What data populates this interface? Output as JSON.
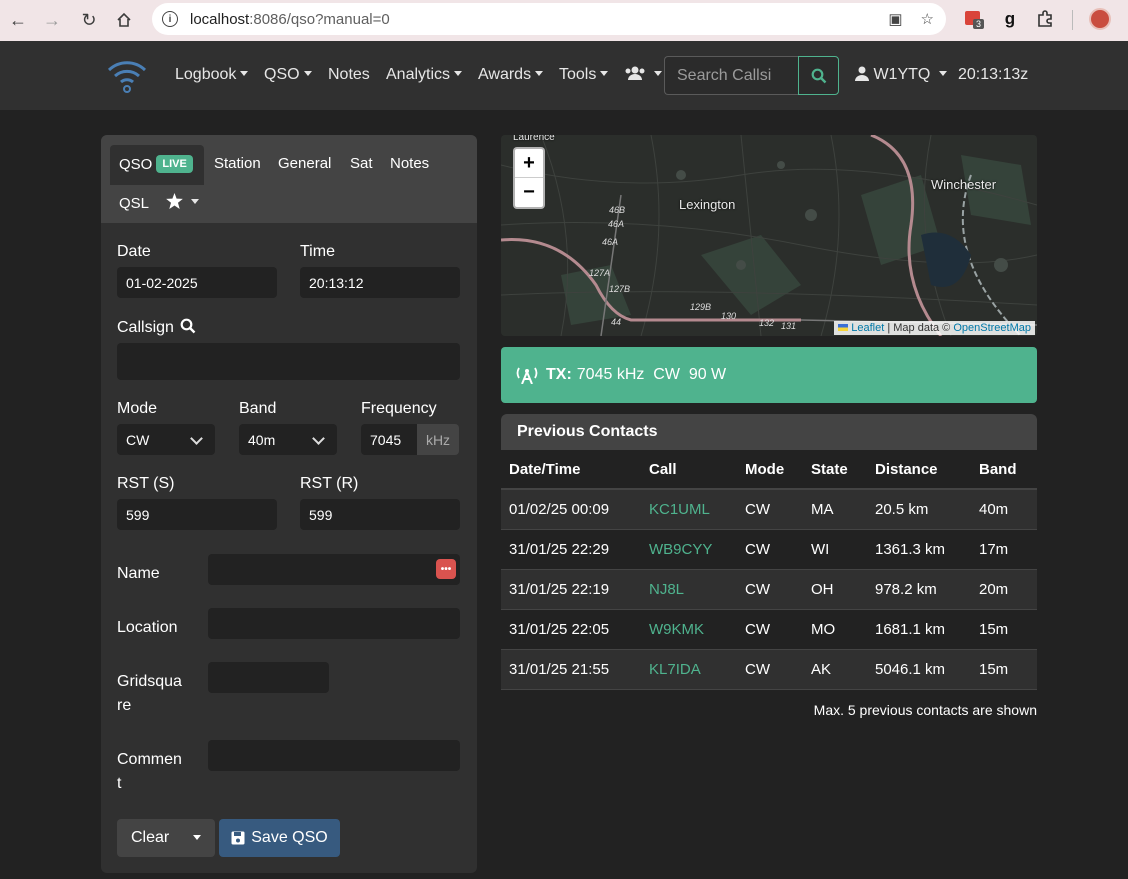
{
  "browser": {
    "url_host": "localhost",
    "url_rest": ":8086/qso?manual=0",
    "ext_badge": "3"
  },
  "navbar": {
    "items": [
      {
        "label": "Logbook"
      },
      {
        "label": "QSO"
      },
      {
        "label": "Notes"
      },
      {
        "label": "Analytics"
      },
      {
        "label": "Awards"
      },
      {
        "label": "Tools"
      }
    ],
    "search_placeholder": "Search Callsi",
    "user": "W1YTQ",
    "clock": "20:13:13z"
  },
  "tabs": {
    "qso": "QSO",
    "live_badge": "LIVE",
    "station": "Station",
    "general": "General",
    "sat": "Sat",
    "notes": "Notes",
    "qsl": "QSL"
  },
  "form": {
    "date_label": "Date",
    "date_value": "01-02-2025",
    "time_label": "Time",
    "time_value": "20:13:12",
    "callsign_label": "Callsign",
    "mode_label": "Mode",
    "mode_value": "CW",
    "band_label": "Band",
    "band_value": "40m",
    "freq_label": "Frequency",
    "freq_value": "7045",
    "freq_unit": "kHz",
    "rst_s_label": "RST (S)",
    "rst_s_value": "599",
    "rst_r_label": "RST (R)",
    "rst_r_value": "599",
    "name_label": "Name",
    "location_label": "Location",
    "grid_label_1": "Gridsqua",
    "grid_label_2": "re",
    "comment_label_1": "Commen",
    "comment_label_2": "t",
    "clear_btn": "Clear",
    "save_btn": "Save QSO"
  },
  "map": {
    "labels": {
      "lexington": "Lexington",
      "winchester": "Winchester",
      "laurence": "Laurence"
    },
    "numbers": [
      "46B",
      "46A",
      "46A",
      "127A",
      "127B",
      "129B",
      "130",
      "132",
      "131",
      "44"
    ],
    "zoom_in": "+",
    "zoom_out": "−",
    "attrib_leaflet": "Leaflet",
    "attrib_mid": " | Map data © ",
    "attrib_osm": "OpenStreetMap"
  },
  "tx": {
    "prefix": "TX:",
    "text": "7045 kHz  CW  90 W"
  },
  "previous": {
    "title": "Previous Contacts",
    "headers": [
      "Date/Time",
      "Call",
      "Mode",
      "State",
      "Distance",
      "Band"
    ],
    "rows": [
      [
        "01/02/25 00:09",
        "KC1UML",
        "CW",
        "MA",
        "20.5 km",
        "40m"
      ],
      [
        "31/01/25 22:29",
        "WB9CYY",
        "CW",
        "WI",
        "1361.3 km",
        "17m"
      ],
      [
        "31/01/25 22:19",
        "NJ8L",
        "CW",
        "OH",
        "978.2 km",
        "20m"
      ],
      [
        "31/01/25 22:05",
        "W9KMK",
        "CW",
        "MO",
        "1681.1 km",
        "15m"
      ],
      [
        "31/01/25 21:55",
        "KL7IDA",
        "CW",
        "AK",
        "5046.1 km",
        "15m"
      ]
    ],
    "note": "Max. 5 previous contacts are shown"
  }
}
